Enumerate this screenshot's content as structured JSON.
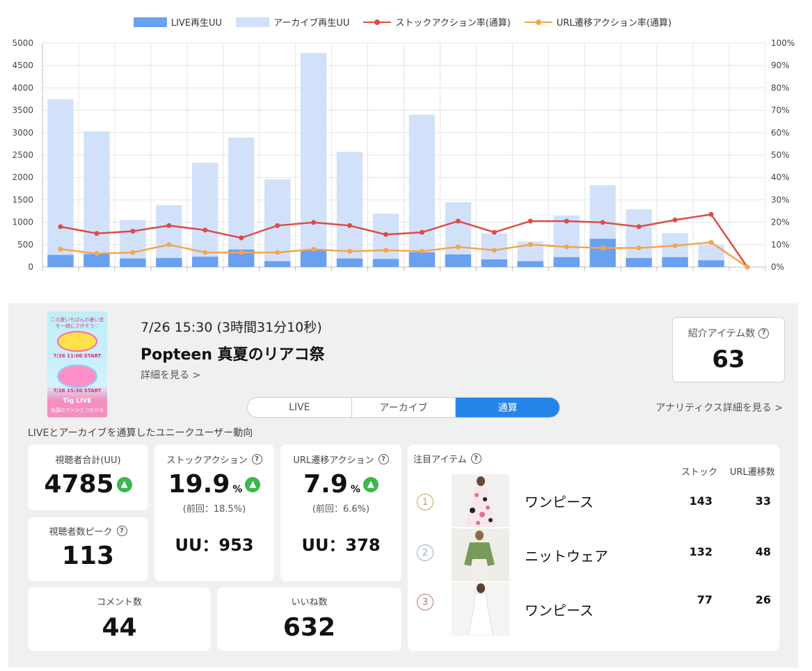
{
  "chart_data": {
    "type": "bar",
    "legend": [
      "LIVE再生UU",
      "アーカイブ再生UU",
      "ストックアクション率(通算)",
      "URL遷移アクション率(通算)"
    ],
    "colors": [
      "#6aa0f0",
      "#d2e1fa",
      "#dc4c45",
      "#f4a54e"
    ],
    "legend_placement": "top",
    "y_left": {
      "min": 0,
      "max": 5000,
      "ticks": [
        "0",
        "500",
        "1000",
        "1500",
        "2000",
        "2500",
        "3000",
        "3500",
        "4000",
        "4500",
        "5000"
      ]
    },
    "y_right": {
      "min": 0,
      "max": 100,
      "ticks": [
        "0%",
        "10%",
        "20%",
        "30%",
        "40%",
        "50%",
        "60%",
        "70%",
        "80%",
        "90%",
        "100%"
      ]
    },
    "grid": true,
    "series": [
      {
        "name": "LIVE再生UU",
        "axis": "left",
        "type": "bar",
        "values": [
          270,
          290,
          190,
          200,
          230,
          390,
          130,
          370,
          190,
          180,
          330,
          280,
          170,
          130,
          220,
          630,
          200,
          220,
          150
        ]
      },
      {
        "name": "アーカイブ再生UU",
        "axis": "left",
        "type": "bar",
        "values": [
          3750,
          3030,
          1050,
          1380,
          2330,
          2890,
          1960,
          4780,
          2570,
          1190,
          3400,
          1450,
          750,
          570,
          1150,
          1830,
          1290,
          760,
          490
        ]
      },
      {
        "name": "ストックアクション率(通算)",
        "axis": "right",
        "type": "line",
        "values": [
          18,
          15,
          16,
          18.5,
          16.5,
          13,
          18.5,
          19.9,
          18.5,
          14.5,
          15.5,
          20.5,
          15.5,
          20.5,
          20.5,
          19.9,
          18,
          21,
          23.5,
          0
        ]
      },
      {
        "name": "URL遷移アクション率(通算)",
        "axis": "right",
        "type": "line",
        "values": [
          8,
          6,
          6.5,
          10,
          6.5,
          6.5,
          6.5,
          7.9,
          7,
          7.5,
          7,
          9,
          7.5,
          10,
          9,
          8.5,
          8.5,
          9.5,
          11,
          0
        ]
      }
    ]
  },
  "event": {
    "date": "7/26 15:30 (3時間31分10秒)",
    "title": "Popteen 真夏のリアコ祭",
    "detail_link": "詳細を見る >",
    "thumbnail": {
      "line1": "この夏いちばんの暑い恋を一緒にさがそう♡",
      "date1": "7/26 11:00 START",
      "date2": "7/26 15:30 START",
      "brand": "Tig LIVE",
      "footer": "全国のファンとつながる"
    }
  },
  "intro_items": {
    "label": "紹介アイテム数",
    "value": "63"
  },
  "tabs": [
    {
      "label": "LIVE"
    },
    {
      "label": "アーカイブ"
    },
    {
      "label": "通算",
      "active": true
    }
  ],
  "analytics_link": "アナリティクス詳細を見る >",
  "section_label": "LIVEとアーカイブを通算したユニークユーザー動向",
  "stats": {
    "total_viewers": {
      "label": "視聴者合計(UU)",
      "value": "4785"
    },
    "peak_viewers": {
      "label": "視聴者数ピーク",
      "value": "113"
    },
    "stock_action": {
      "label": "ストックアクション",
      "value": "19.9",
      "unit": "%",
      "prev": "(前回：18.5%)",
      "uu": "UU：953"
    },
    "url_action": {
      "label": "URL遷移アクション",
      "value": "7.9",
      "unit": "%",
      "prev": "(前回：6.6%)",
      "uu": "UU：378"
    },
    "comments": {
      "label": "コメント数",
      "value": "44"
    },
    "likes": {
      "label": "いいね数",
      "value": "632"
    }
  },
  "featured": {
    "title": "注目アイテム",
    "col_stock": "ストック",
    "col_url": "URL遷移数",
    "rank_colors": [
      "#c9a25a",
      "#8fb0c8",
      "#b07a65"
    ],
    "items": [
      {
        "rank": "1",
        "name": "ワンピース",
        "stock": "143",
        "url": "33"
      },
      {
        "rank": "2",
        "name": "ニットウェア",
        "stock": "132",
        "url": "48"
      },
      {
        "rank": "3",
        "name": "ワンピース",
        "stock": "77",
        "url": "26"
      }
    ]
  },
  "icons": {
    "help": "?",
    "up": "▲"
  }
}
